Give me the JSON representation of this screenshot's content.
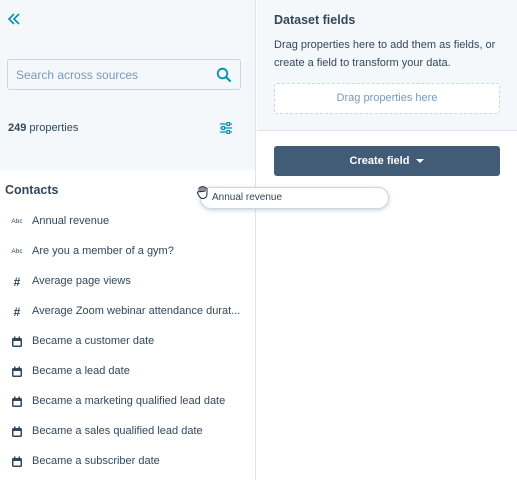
{
  "left": {
    "search": {
      "placeholder": "Search across sources"
    },
    "properties": {
      "count": "249",
      "label": "properties"
    },
    "section_title": "Contacts",
    "items": [
      {
        "icon": "Abc",
        "icon_name": "text-type-icon",
        "label": "Annual revenue"
      },
      {
        "icon": "Abc",
        "icon_name": "text-type-icon",
        "label": "Are you a member of a gym?"
      },
      {
        "icon": "#",
        "icon_name": "number-type-icon",
        "label": "Average page views"
      },
      {
        "icon": "#",
        "icon_name": "number-type-icon",
        "label": "Average Zoom webinar attendance durat..."
      },
      {
        "icon": "",
        "icon_name": "calendar-icon",
        "label": "Became a customer date"
      },
      {
        "icon": "",
        "icon_name": "calendar-icon",
        "label": "Became a lead date"
      },
      {
        "icon": "",
        "icon_name": "calendar-icon",
        "label": "Became a marketing qualified lead date"
      },
      {
        "icon": "",
        "icon_name": "calendar-icon",
        "label": "Became a sales qualified lead date"
      },
      {
        "icon": "",
        "icon_name": "calendar-icon",
        "label": "Became a subscriber date"
      }
    ]
  },
  "right": {
    "title": "Dataset fields",
    "description": "Drag properties here to add them as fields, or create a field to transform your data.",
    "drop_zone": "Drag properties here",
    "create_button": "Create field"
  },
  "drag_chip": {
    "label": "Annual revenue"
  },
  "colors": {
    "accent": "#0091ae",
    "text": "#33475b",
    "muted": "#7c98b6",
    "button": "#425b76",
    "panel_bg": "#f5f8fa",
    "border": "#cbd6e2"
  }
}
